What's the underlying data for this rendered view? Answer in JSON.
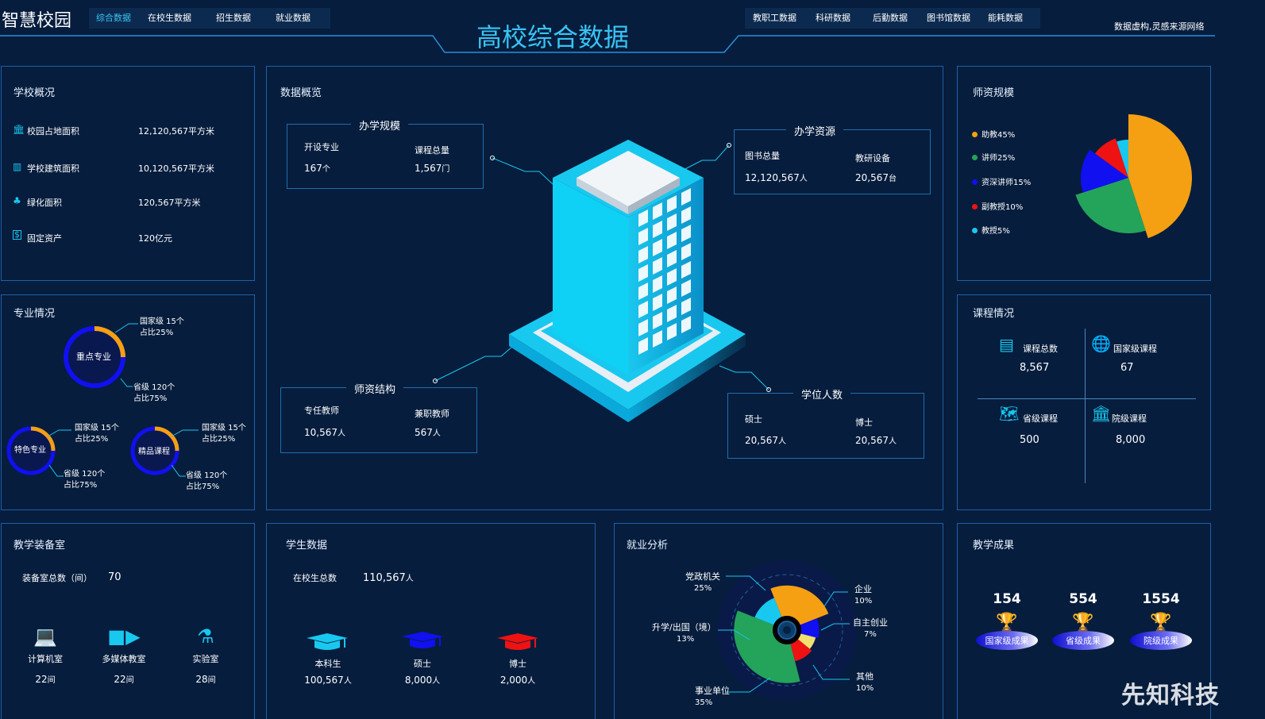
{
  "header": {
    "logo": "智慧校园",
    "title": "高校综合数据",
    "left_nav": [
      "综合数据",
      "在校生数据",
      "招生数据",
      "就业数据"
    ],
    "right_nav": [
      "教职工数据",
      "科研数据",
      "后勤数据",
      "图书馆数据",
      "能耗数据"
    ],
    "note": "数据虚构,灵感来源网络"
  },
  "school": {
    "title": "学校概况",
    "items": [
      {
        "label": "校园占地面积",
        "value": "12,120,567平方米",
        "icon": "building-icon"
      },
      {
        "label": "学校建筑面积",
        "value": "10,120,567平方米",
        "icon": "office-icon"
      },
      {
        "label": "绿化面积",
        "value": "120,567平方米",
        "icon": "tree-icon"
      },
      {
        "label": "固定资产",
        "value": "120亿元",
        "icon": "money-icon"
      }
    ]
  },
  "major": {
    "title": "专业情况",
    "rings": [
      {
        "name": "重点专业",
        "national": "国家级 15个",
        "national_pct": "占比25%",
        "province": "省级 120个",
        "province_pct": "占比75%",
        "fraction": 0.25
      },
      {
        "name": "特色专业",
        "national": "国家级 15个",
        "national_pct": "占比25%",
        "province": "省级 120个",
        "province_pct": "占比75%",
        "fraction": 0.25
      },
      {
        "name": "精品课程",
        "national": "国家级 15个",
        "national_pct": "占比25%",
        "province": "省级 120个",
        "province_pct": "占比75%",
        "fraction": 0.25
      }
    ]
  },
  "overview": {
    "title": "数据概览",
    "scale": {
      "title": "办学规模",
      "a_label": "开设专业",
      "a_value": "167",
      "a_unit": "个",
      "b_label": "课程总量",
      "b_value": "1,567",
      "b_unit": "门"
    },
    "resource": {
      "title": "办学资源",
      "a_label": "图书总量",
      "a_value": "12,120,567",
      "a_unit": "人",
      "b_label": "教研设备",
      "b_value": "20,567",
      "b_unit": "台"
    },
    "faculty": {
      "title": "师资结构",
      "a_label": "专任教师",
      "a_value": "10,567",
      "a_unit": "人",
      "b_label": "兼职教师",
      "b_value": "567",
      "b_unit": "人"
    },
    "degree": {
      "title": "学位人数",
      "a_label": "硕士",
      "a_value": "20,567",
      "a_unit": "人",
      "b_label": "博士",
      "b_value": "20,567",
      "b_unit": "人"
    }
  },
  "teachers": {
    "title": "师资规模",
    "legend": [
      "助教45%",
      "讲师25%",
      "资深讲师15%",
      "副教授10%",
      "教授5%"
    ],
    "colors": [
      "#f5a012",
      "#24a35a",
      "#1010f0",
      "#ee1212",
      "#19c8ef"
    ]
  },
  "courses": {
    "title": "课程情况",
    "items": [
      {
        "label": "课程总数",
        "value": "8,567",
        "icon": "book-icon"
      },
      {
        "label": "国家级课程",
        "value": "67",
        "icon": "globe-icon"
      },
      {
        "label": "省级课程",
        "value": "500",
        "icon": "map-icon"
      },
      {
        "label": "院级课程",
        "value": "8,000",
        "icon": "institution-icon"
      }
    ]
  },
  "equipment": {
    "title": "教学装备室",
    "total_label": "装备室总数（间）",
    "total_value": "70",
    "items": [
      {
        "label": "计算机室",
        "value": "22",
        "unit": "间",
        "icon": "laptop-icon"
      },
      {
        "label": "多媒体教室",
        "value": "22",
        "unit": "间",
        "icon": "video-icon"
      },
      {
        "label": "实验室",
        "value": "28",
        "unit": "间",
        "icon": "flask-icon"
      }
    ]
  },
  "students": {
    "title": "学生数据",
    "total_label": "在校生总数",
    "total_value": "110,567",
    "total_unit": "人",
    "items": [
      {
        "label": "本科生",
        "value": "100,567",
        "unit": "人",
        "color": "#19c8ef"
      },
      {
        "label": "硕士",
        "value": "8,000",
        "unit": "人",
        "color": "#1010f0"
      },
      {
        "label": "博士",
        "value": "2,000",
        "unit": "人",
        "color": "#ee1212"
      }
    ]
  },
  "employment": {
    "title": "就业分析",
    "segments": [
      {
        "name": "党政机关",
        "pct": "25%",
        "color": "#f5a012",
        "value": 25
      },
      {
        "name": "企业",
        "pct": "10%",
        "color": "#1010f0",
        "value": 10
      },
      {
        "name": "自主创业",
        "pct": "7%",
        "color": "#f0e070",
        "value": 7
      },
      {
        "name": "其他",
        "pct": "10%",
        "color": "#ee1212",
        "value": 10
      },
      {
        "name": "事业单位",
        "pct": "35%",
        "color": "#24a35a",
        "value": 35
      },
      {
        "name": "升学/出国（境）",
        "pct": "13%",
        "color": "#19c8ef",
        "value": 13
      }
    ]
  },
  "achievements": {
    "title": "教学成果",
    "items": [
      {
        "value": "154",
        "label": "国家级成果"
      },
      {
        "value": "554",
        "label": "省级成果"
      },
      {
        "value": "1554",
        "label": "院级成果"
      }
    ]
  },
  "watermark": "先知科技"
}
